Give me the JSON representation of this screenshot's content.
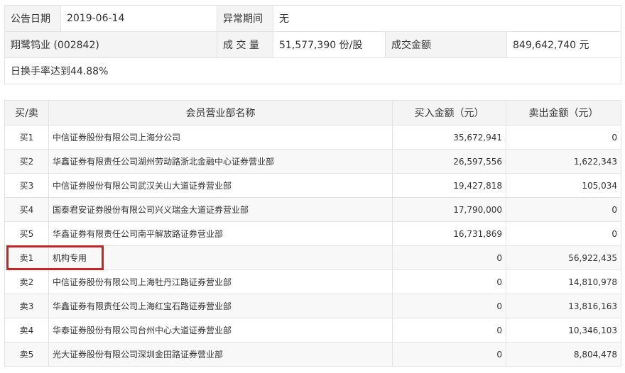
{
  "info": {
    "announce_date_label": "公告日期",
    "announce_date_value": "2019-06-14",
    "abnormal_period_label": "异常期间",
    "abnormal_period_value": "无",
    "stock_name": "翔鹭钨业 (002842)",
    "volume_label": "成 交 量",
    "volume_value": "51,577,390 份/股",
    "amount_label": "成交金额",
    "amount_value": "849,642,740 元",
    "reason": "日换手率达到44.88%"
  },
  "detail": {
    "headers": {
      "side": "买/卖",
      "dept": "会员营业部名称",
      "buy": "买入金额（元）",
      "sell": "卖出金额（元）"
    },
    "rows": [
      {
        "side": "买1",
        "dept": "中信证券股份有限公司上海分公司",
        "buy": "35,672,941",
        "sell": "0"
      },
      {
        "side": "买2",
        "dept": "华鑫证券有限责任公司湖州劳动路浙北金融中心证券营业部",
        "buy": "26,597,556",
        "sell": "1,622,343"
      },
      {
        "side": "买3",
        "dept": "中信证券股份有限公司武汉关山大道证券营业部",
        "buy": "19,427,818",
        "sell": "105,034"
      },
      {
        "side": "买4",
        "dept": "国泰君安证券股份有限公司兴义瑞金大道证券营业部",
        "buy": "17,790,000",
        "sell": "0"
      },
      {
        "side": "买5",
        "dept": "华鑫证券有限责任公司南平解放路证券营业部",
        "buy": "16,731,869",
        "sell": "0"
      },
      {
        "side": "卖1",
        "dept": "机构专用",
        "buy": "0",
        "sell": "56,922,435"
      },
      {
        "side": "卖2",
        "dept": "中信证券股份有限公司上海牡丹江路证券营业部",
        "buy": "0",
        "sell": "14,810,978"
      },
      {
        "side": "卖3",
        "dept": "华鑫证券有限责任公司上海红宝石路证券营业部",
        "buy": "0",
        "sell": "13,816,163"
      },
      {
        "side": "卖4",
        "dept": "华泰证券股份有限公司台州中心大道证券营业部",
        "buy": "0",
        "sell": "10,346,103"
      },
      {
        "side": "卖5",
        "dept": "光大证券股份有限公司深圳金田路证券营业部",
        "buy": "0",
        "sell": "8,804,478"
      }
    ]
  },
  "highlight_color": "#c82323"
}
